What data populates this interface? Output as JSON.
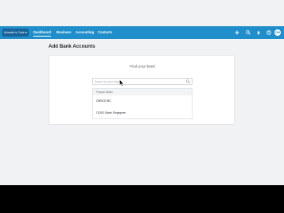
{
  "header": {
    "org_switcher": "Woodie's Cafe ▾",
    "nav": [
      "Dashboard",
      "Business",
      "Accounting",
      "Contacts"
    ],
    "icons": [
      "plus-icon",
      "search-icon",
      "bell-icon",
      "help-icon"
    ],
    "avatar_initials": "DM"
  },
  "page": {
    "title": "Add Bank Accounts"
  },
  "finder": {
    "heading": "Find your bank",
    "search_placeholder": "Search for your bank",
    "section_label": "Popular Banks",
    "options": [
      "DBS/OCBC",
      "OCBC Bank Singapore"
    ]
  },
  "colors": {
    "nav_bar": "#1f8ecb",
    "org_switcher": "#17639a",
    "background": "#f1f2f4"
  }
}
